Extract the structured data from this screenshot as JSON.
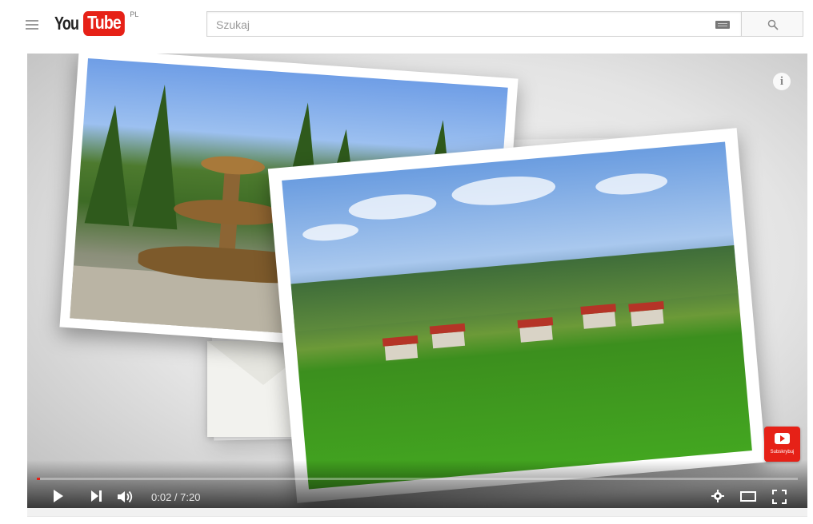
{
  "header": {
    "logo_text_you": "You",
    "logo_text_tube": "Tube",
    "country_code": "PL",
    "search_placeholder": "Szukaj"
  },
  "player": {
    "time_display": "0:02 / 7:20",
    "progress_fraction": 0.0045,
    "subscribe_label": "Subskrybuj",
    "colors": {
      "brand_red": "#e62117",
      "control_text": "#e6e6e6"
    },
    "icons": [
      "menu-icon",
      "keyboard-icon",
      "search-icon",
      "info-icon",
      "subscribe-icon",
      "play-icon",
      "next-icon",
      "volume-icon",
      "settings-icon",
      "theater-mode-icon",
      "fullscreen-icon"
    ]
  }
}
